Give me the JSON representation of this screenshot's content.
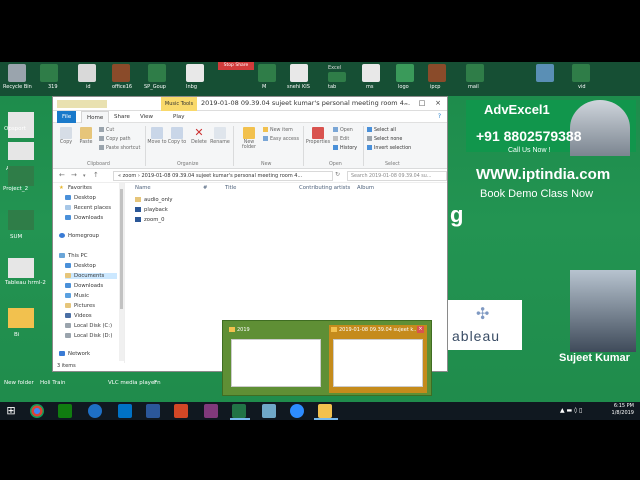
{
  "top_strip": {
    "labels": [
      "Recycle Bin",
      "319",
      "id",
      "office16",
      "SP_Goup",
      "Inbg",
      "",
      "M",
      "snehi KIS",
      "tab",
      "ms",
      "logo",
      "ipcp",
      "mail",
      "",
      "vid"
    ],
    "stop_share": "Stop Share",
    "excel_tag": "Excel"
  },
  "desktop_left": {
    "labels": [
      "Opsport",
      "A1",
      "Project_2",
      "SUM",
      "Tableau hrml-2",
      "Bi"
    ]
  },
  "window": {
    "title": "2019-01-08 09.39.04 sujeet kumar's personal meeting room 4...",
    "context_tab": "Music Tools",
    "tabs": [
      "File",
      "Home",
      "Share",
      "View",
      "Play"
    ],
    "ribbon": {
      "copy": "Copy",
      "paste": "Paste",
      "cut": "Cut",
      "copy_path": "Copy path",
      "paste_shortcut": "Paste shortcut",
      "move_to": "Move to",
      "copy_to": "Copy to",
      "delete": "Delete",
      "rename": "Rename",
      "new_folder": "New folder",
      "new_item": "New item",
      "easy_access": "Easy access",
      "properties": "Properties",
      "open": "Open",
      "edit": "Edit",
      "history": "History",
      "select_all": "Select all",
      "select_none": "Select none",
      "invert_selection": "Invert selection",
      "groups": [
        "Clipboard",
        "Organize",
        "New",
        "Open",
        "Select"
      ]
    },
    "address": "« zoom › 2019-01-08 09.39.04 sujeet kumar's personal meeting room 4...",
    "search_placeholder": "Search 2019-01-08 09.39.04 su...",
    "nav": {
      "favorites": "Favorites",
      "fav_items": [
        "Desktop",
        "Recent places",
        "Downloads"
      ],
      "homegroup": "Homegroup",
      "this_pc": "This PC",
      "pc_items": [
        "Desktop",
        "Documents",
        "Downloads",
        "Music",
        "Pictures",
        "Videos",
        "Local Disk (C:)",
        "Local Disk (D:)"
      ],
      "network": "Network"
    },
    "columns": [
      "Name",
      "#",
      "Title",
      "Contributing artists",
      "Album"
    ],
    "files": [
      "audio_only",
      "playback",
      "zoom_0"
    ],
    "status": "3 items"
  },
  "ad": {
    "title": "AdvExcel1",
    "phone": "+91 8802579388",
    "call": "Call Us Now !",
    "website": "WWW.iptindia.com",
    "demo": "Book Demo Class Now",
    "tableau": "ableau",
    "presenter": "Sujeet Kumar",
    "partial_word": "g"
  },
  "preview": {
    "cards": [
      "2019",
      "2019-01-08 09.39.04 sujeet k..."
    ]
  },
  "desktop_bottom": {
    "labels": [
      "New folder",
      "Holi Train",
      "VLC media player",
      "Fn"
    ]
  },
  "tray": {
    "time": "6:15 PM",
    "date": "1/8/2019"
  }
}
